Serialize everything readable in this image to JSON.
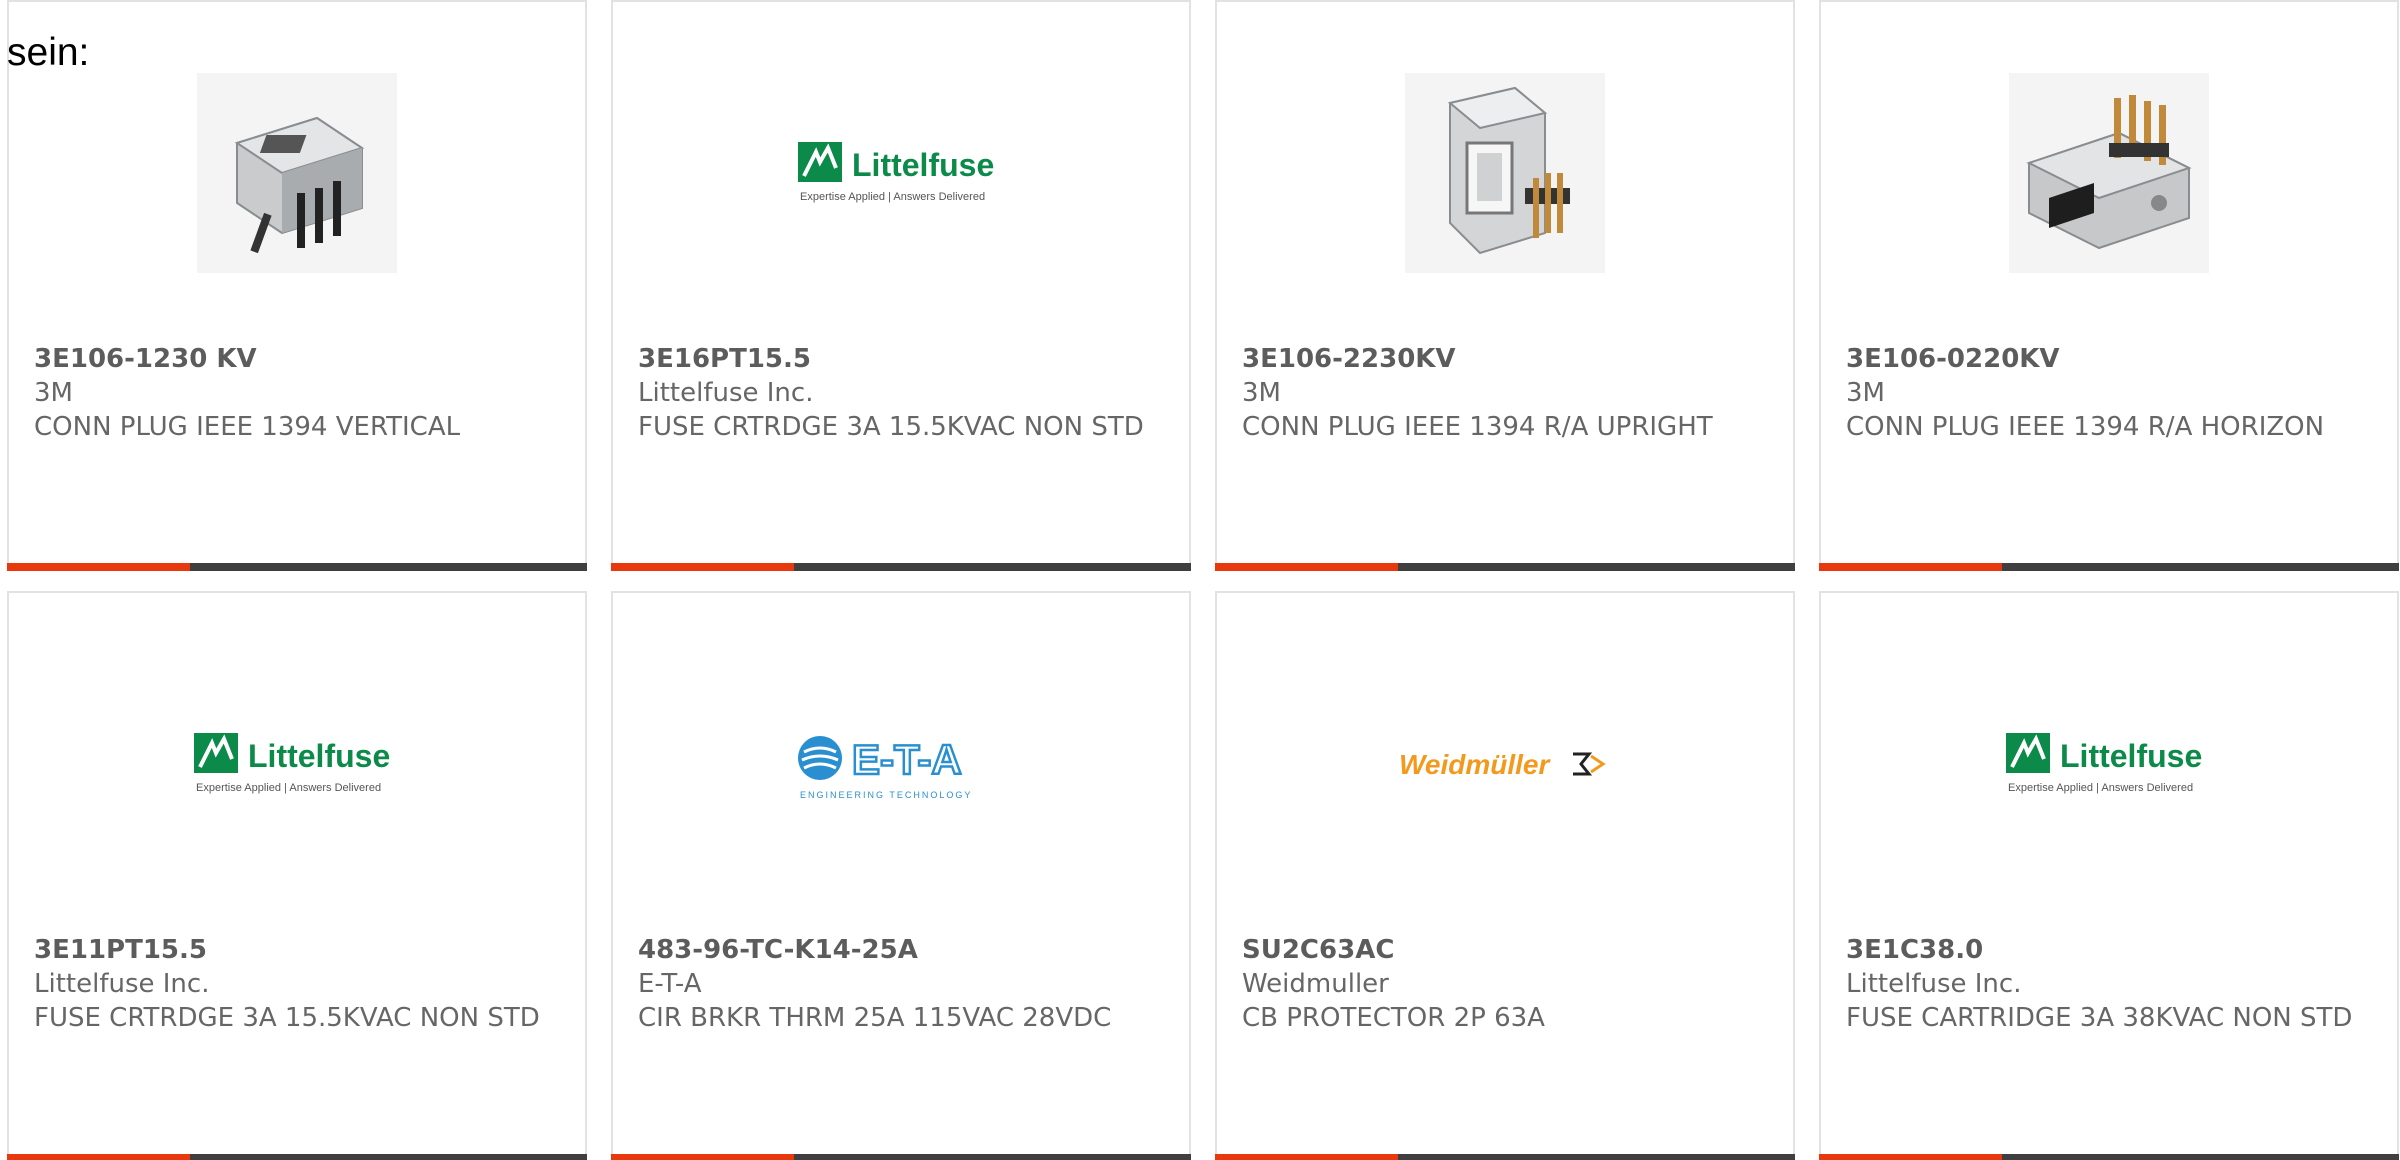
{
  "intro": "sein:",
  "colors": {
    "accent_bar": "#e8380d",
    "bar": "#3f3f3f",
    "card_border": "#e2e2e2",
    "text": "#666666",
    "littelfuse_green": "#0b8a4a",
    "eta_blue": "#2a8fd0",
    "weidmuller_orange": "#f39a1e"
  },
  "products": [
    {
      "part_number": "3E106-1230 KV",
      "manufacturer": "3M",
      "description": "CONN PLUG IEEE 1394 VERTICAL",
      "image": "connector-vertical-icon"
    },
    {
      "part_number": "3E16PT15.5",
      "manufacturer": "Littelfuse Inc.",
      "description": "FUSE CRTRDGE 3A 15.5KVAC NON STD",
      "image": "littelfuse-logo",
      "logo": {
        "name": "Littelfuse",
        "tagline": "Expertise Applied | Answers Delivered"
      }
    },
    {
      "part_number": "3E106-2230KV",
      "manufacturer": "3M",
      "description": "CONN PLUG IEEE 1394 R/A UPRIGHT",
      "image": "connector-upright-icon"
    },
    {
      "part_number": "3E106-0220KV",
      "manufacturer": "3M",
      "description": "CONN PLUG IEEE 1394 R/A HORIZON",
      "image": "connector-horizontal-icon"
    },
    {
      "part_number": "3E11PT15.5",
      "manufacturer": "Littelfuse Inc.",
      "description": "FUSE CRTRDGE 3A 15.5KVAC NON STD",
      "image": "littelfuse-logo",
      "logo": {
        "name": "Littelfuse",
        "tagline": "Expertise Applied | Answers Delivered"
      }
    },
    {
      "part_number": "483-96-TC-K14-25A",
      "manufacturer": "E-T-A",
      "description": "CIR BRKR THRM 25A 115VAC 28VDC",
      "image": "eta-logo",
      "logo": {
        "name": "E-T-A",
        "tagline": "ENGINEERING TECHNOLOGY"
      }
    },
    {
      "part_number": "SU2C63AC",
      "manufacturer": "Weidmuller",
      "description": "CB PROTECTOR 2P 63A",
      "image": "weidmuller-logo",
      "logo": {
        "name": "Weidmüller"
      }
    },
    {
      "part_number": "3E1C38.0",
      "manufacturer": "Littelfuse Inc.",
      "description": "FUSE CARTRIDGE 3A 38KVAC NON STD",
      "image": "littelfuse-logo",
      "logo": {
        "name": "Littelfuse",
        "tagline": "Expertise Applied | Answers Delivered"
      }
    }
  ]
}
